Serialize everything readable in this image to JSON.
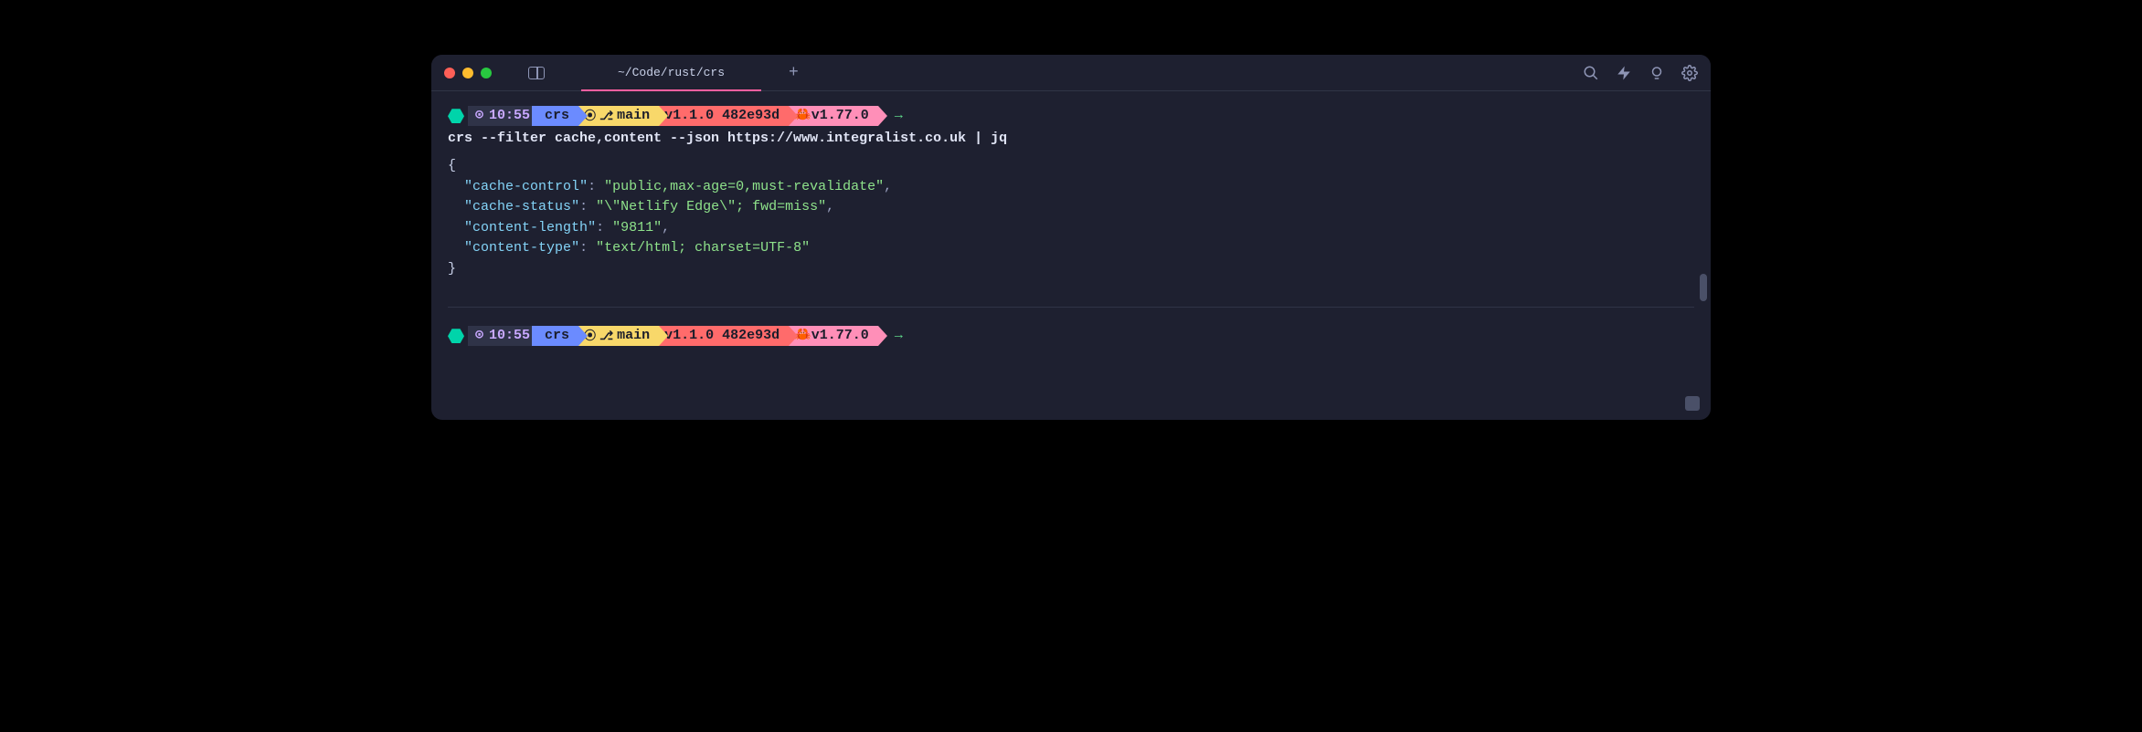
{
  "tab_title": "~/Code/rust/crs",
  "prompt": {
    "time": "10:55",
    "dir": "crs",
    "branch": "main",
    "version_tag": "v1.1.0 482e93d",
    "rust_version": "v1.77.0",
    "crab_emoji": "🦀"
  },
  "command": "crs --filter cache,content --json https://www.integralist.co.uk | jq",
  "json_output": {
    "cache-control": "public,max-age=0,must-revalidate",
    "cache-status": "\\\"Netlify Edge\\\"; fwd=miss",
    "content-length": "9811",
    "content-type": "text/html; charset=UTF-8"
  },
  "json_keys": [
    "cache-control",
    "cache-status",
    "content-length",
    "content-type"
  ],
  "json_vals": [
    "\"public,max-age=0,must-revalidate\"",
    "\"\\\"Netlify Edge\\\"; fwd=miss\"",
    "\"9811\"",
    "\"text/html; charset=UTF-8\""
  ],
  "arrow": "→",
  "plus": "+",
  "clock_glyph": "⊙",
  "gh_glyph": "⎇",
  "github_glyph": "○"
}
